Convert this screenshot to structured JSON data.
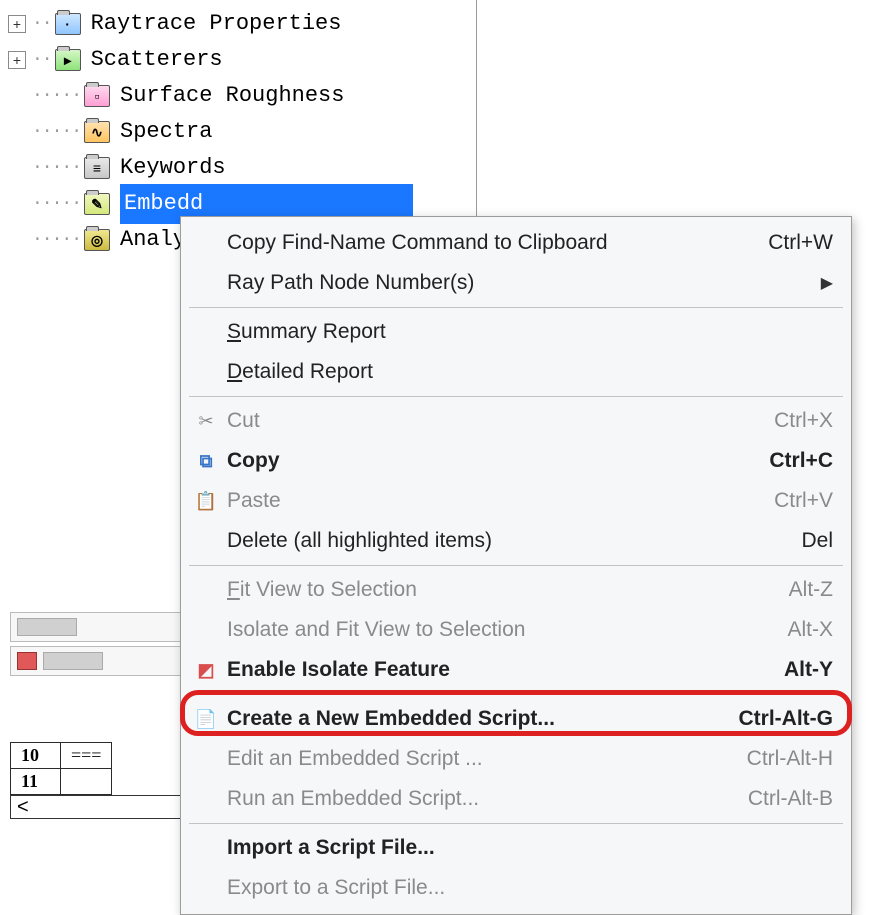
{
  "tree": {
    "items": [
      {
        "label": "Raytrace Properties",
        "icon": "blue",
        "expandable": true
      },
      {
        "label": "Scatterers",
        "icon": "green",
        "expandable": true
      },
      {
        "label": "Surface Roughness",
        "icon": "pink",
        "expandable": false,
        "indent": true
      },
      {
        "label": "Spectra",
        "icon": "orange",
        "expandable": false,
        "indent": true
      },
      {
        "label": "Keywords",
        "icon": "gray",
        "expandable": false,
        "indent": true
      },
      {
        "label": "Embedd",
        "icon": "lime",
        "expandable": false,
        "indent": true,
        "selected": true
      },
      {
        "label": "Analys",
        "icon": "oliv",
        "expandable": false,
        "indent": true
      }
    ]
  },
  "menu": {
    "items": [
      {
        "label": "Copy Find-Name Command to Clipboard",
        "hotkey": "Ctrl+W",
        "enabled": true
      },
      {
        "label": "Ray Path Node Number(s)",
        "submenu": true,
        "enabled": true
      },
      {
        "sep": true
      },
      {
        "label": "Summary Report",
        "underline": "S",
        "enabled": true
      },
      {
        "label": "Detailed Report",
        "underline": "D",
        "enabled": true
      },
      {
        "sep": true
      },
      {
        "label": "Cut",
        "icon": "cut",
        "hotkey": "Ctrl+X",
        "enabled": false
      },
      {
        "label": "Copy",
        "icon": "copy",
        "hotkey": "Ctrl+C",
        "enabled": true
      },
      {
        "label": "Paste",
        "icon": "paste",
        "hotkey": "Ctrl+V",
        "enabled": false
      },
      {
        "label": "Delete (all highlighted items)",
        "hotkey": "Del",
        "enabled": true
      },
      {
        "sep": true
      },
      {
        "label": "Fit View to Selection",
        "underline": "F",
        "hotkey": "Alt-Z",
        "enabled": false
      },
      {
        "label": "Isolate and Fit View to Selection",
        "hotkey": "Alt-X",
        "enabled": false
      },
      {
        "label": "Enable Isolate Feature",
        "icon": "isolate",
        "hotkey": "Alt-Y",
        "enabled": true,
        "bold": true
      },
      {
        "sep": true
      },
      {
        "label": "Create a New Embedded Script...",
        "icon": "script",
        "hotkey": "Ctrl-Alt-G",
        "enabled": true,
        "bold": true,
        "highlighted": true
      },
      {
        "label": "Edit an Embedded Script ...",
        "hotkey": "Ctrl-Alt-H",
        "enabled": false
      },
      {
        "label": "Run an Embedded Script...",
        "hotkey": "Ctrl-Alt-B",
        "enabled": false
      },
      {
        "sep": true
      },
      {
        "label": "Import a Script File...",
        "enabled": true,
        "bold": true
      },
      {
        "label": "Export to a Script File...",
        "enabled": false
      }
    ]
  },
  "lower": {
    "row10_num": "10",
    "row10_val": "===",
    "row11_num": "11",
    "scroll_sym": "<"
  },
  "colors": {
    "selection": "#1a77ff",
    "highlight_border": "#dd2020"
  }
}
